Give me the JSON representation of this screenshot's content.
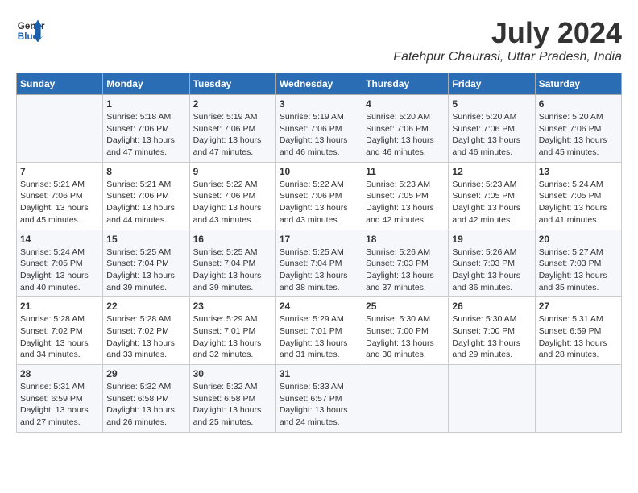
{
  "logo": {
    "line1": "General",
    "line2": "Blue"
  },
  "title": "July 2024",
  "subtitle": "Fatehpur Chaurasi, Uttar Pradesh, India",
  "days_header": [
    "Sunday",
    "Monday",
    "Tuesday",
    "Wednesday",
    "Thursday",
    "Friday",
    "Saturday"
  ],
  "weeks": [
    [
      {
        "day": "",
        "info": ""
      },
      {
        "day": "1",
        "info": "Sunrise: 5:18 AM\nSunset: 7:06 PM\nDaylight: 13 hours\nand 47 minutes."
      },
      {
        "day": "2",
        "info": "Sunrise: 5:19 AM\nSunset: 7:06 PM\nDaylight: 13 hours\nand 47 minutes."
      },
      {
        "day": "3",
        "info": "Sunrise: 5:19 AM\nSunset: 7:06 PM\nDaylight: 13 hours\nand 46 minutes."
      },
      {
        "day": "4",
        "info": "Sunrise: 5:20 AM\nSunset: 7:06 PM\nDaylight: 13 hours\nand 46 minutes."
      },
      {
        "day": "5",
        "info": "Sunrise: 5:20 AM\nSunset: 7:06 PM\nDaylight: 13 hours\nand 46 minutes."
      },
      {
        "day": "6",
        "info": "Sunrise: 5:20 AM\nSunset: 7:06 PM\nDaylight: 13 hours\nand 45 minutes."
      }
    ],
    [
      {
        "day": "7",
        "info": "Sunrise: 5:21 AM\nSunset: 7:06 PM\nDaylight: 13 hours\nand 45 minutes."
      },
      {
        "day": "8",
        "info": "Sunrise: 5:21 AM\nSunset: 7:06 PM\nDaylight: 13 hours\nand 44 minutes."
      },
      {
        "day": "9",
        "info": "Sunrise: 5:22 AM\nSunset: 7:06 PM\nDaylight: 13 hours\nand 43 minutes."
      },
      {
        "day": "10",
        "info": "Sunrise: 5:22 AM\nSunset: 7:06 PM\nDaylight: 13 hours\nand 43 minutes."
      },
      {
        "day": "11",
        "info": "Sunrise: 5:23 AM\nSunset: 7:05 PM\nDaylight: 13 hours\nand 42 minutes."
      },
      {
        "day": "12",
        "info": "Sunrise: 5:23 AM\nSunset: 7:05 PM\nDaylight: 13 hours\nand 42 minutes."
      },
      {
        "day": "13",
        "info": "Sunrise: 5:24 AM\nSunset: 7:05 PM\nDaylight: 13 hours\nand 41 minutes."
      }
    ],
    [
      {
        "day": "14",
        "info": "Sunrise: 5:24 AM\nSunset: 7:05 PM\nDaylight: 13 hours\nand 40 minutes."
      },
      {
        "day": "15",
        "info": "Sunrise: 5:25 AM\nSunset: 7:04 PM\nDaylight: 13 hours\nand 39 minutes."
      },
      {
        "day": "16",
        "info": "Sunrise: 5:25 AM\nSunset: 7:04 PM\nDaylight: 13 hours\nand 39 minutes."
      },
      {
        "day": "17",
        "info": "Sunrise: 5:25 AM\nSunset: 7:04 PM\nDaylight: 13 hours\nand 38 minutes."
      },
      {
        "day": "18",
        "info": "Sunrise: 5:26 AM\nSunset: 7:03 PM\nDaylight: 13 hours\nand 37 minutes."
      },
      {
        "day": "19",
        "info": "Sunrise: 5:26 AM\nSunset: 7:03 PM\nDaylight: 13 hours\nand 36 minutes."
      },
      {
        "day": "20",
        "info": "Sunrise: 5:27 AM\nSunset: 7:03 PM\nDaylight: 13 hours\nand 35 minutes."
      }
    ],
    [
      {
        "day": "21",
        "info": "Sunrise: 5:28 AM\nSunset: 7:02 PM\nDaylight: 13 hours\nand 34 minutes."
      },
      {
        "day": "22",
        "info": "Sunrise: 5:28 AM\nSunset: 7:02 PM\nDaylight: 13 hours\nand 33 minutes."
      },
      {
        "day": "23",
        "info": "Sunrise: 5:29 AM\nSunset: 7:01 PM\nDaylight: 13 hours\nand 32 minutes."
      },
      {
        "day": "24",
        "info": "Sunrise: 5:29 AM\nSunset: 7:01 PM\nDaylight: 13 hours\nand 31 minutes."
      },
      {
        "day": "25",
        "info": "Sunrise: 5:30 AM\nSunset: 7:00 PM\nDaylight: 13 hours\nand 30 minutes."
      },
      {
        "day": "26",
        "info": "Sunrise: 5:30 AM\nSunset: 7:00 PM\nDaylight: 13 hours\nand 29 minutes."
      },
      {
        "day": "27",
        "info": "Sunrise: 5:31 AM\nSunset: 6:59 PM\nDaylight: 13 hours\nand 28 minutes."
      }
    ],
    [
      {
        "day": "28",
        "info": "Sunrise: 5:31 AM\nSunset: 6:59 PM\nDaylight: 13 hours\nand 27 minutes."
      },
      {
        "day": "29",
        "info": "Sunrise: 5:32 AM\nSunset: 6:58 PM\nDaylight: 13 hours\nand 26 minutes."
      },
      {
        "day": "30",
        "info": "Sunrise: 5:32 AM\nSunset: 6:58 PM\nDaylight: 13 hours\nand 25 minutes."
      },
      {
        "day": "31",
        "info": "Sunrise: 5:33 AM\nSunset: 6:57 PM\nDaylight: 13 hours\nand 24 minutes."
      },
      {
        "day": "",
        "info": ""
      },
      {
        "day": "",
        "info": ""
      },
      {
        "day": "",
        "info": ""
      }
    ]
  ]
}
